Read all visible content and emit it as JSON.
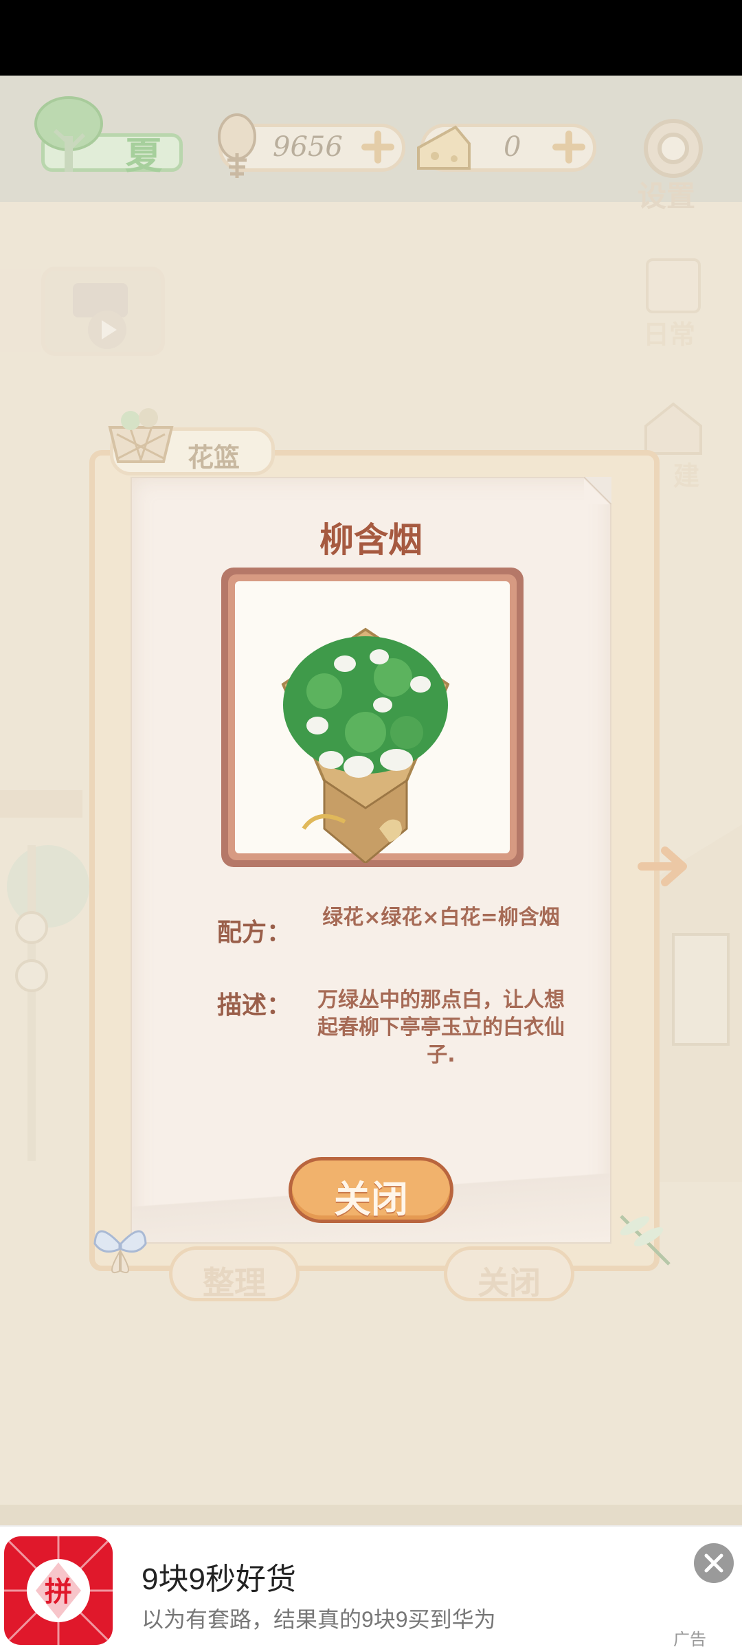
{
  "hud": {
    "season": "夏",
    "fish_count": "9656",
    "cheese_count": "0",
    "settings_label": "设置"
  },
  "side_icons": {
    "daily_label": "日常",
    "build_label": "建"
  },
  "basket": {
    "tab_label": "花篮",
    "organize_label": "整理",
    "close_label": "关闭"
  },
  "detail": {
    "title": "柳含烟",
    "recipe_label": "配方：",
    "recipe_value": "绿花×绿花×白花=柳含烟",
    "description_label": "描述：",
    "description_value": "万绿丛中的那点白，让人想起春柳下亭亭玉立的白衣仙子.",
    "close_button": "关闭"
  },
  "ad": {
    "title": "9块9秒好货",
    "subtitle": "以为有套路，结果真的9块9买到华为",
    "tag": "广告",
    "logo_text": "拼"
  },
  "colors": {
    "accent_orange": "#f1b26c",
    "title_brown": "#a65a40",
    "ad_red": "#e0182b"
  }
}
